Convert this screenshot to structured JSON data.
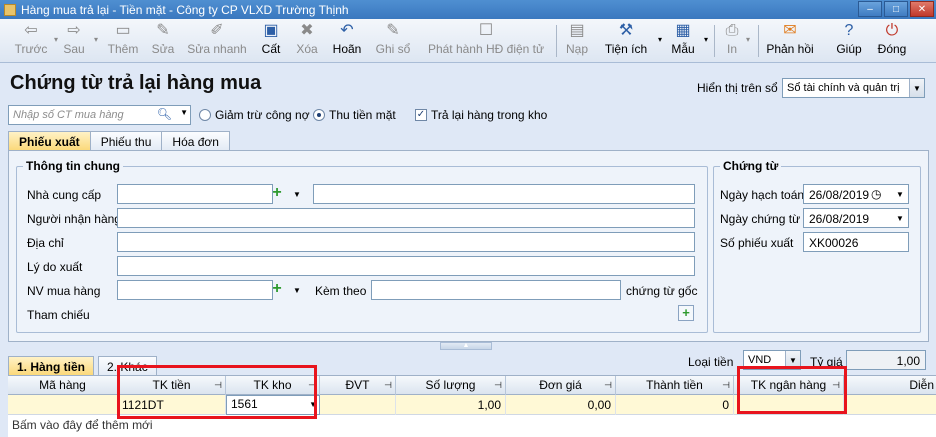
{
  "window": {
    "title": "Hàng mua trả lại - Tiền mặt - Công ty CP VLXD Trường Thịnh",
    "minimize": "–",
    "maximize": "□",
    "close": "✕"
  },
  "toolbar": {
    "back": "Trước",
    "next": "Sau",
    "add": "Thêm",
    "edit": "Sửa",
    "quick_edit": "Sửa nhanh",
    "save": "Cất",
    "delete": "Xóa",
    "undo": "Hoãn",
    "post": "Ghi sổ",
    "issue_invoice": "Phát hành HĐ điện tử",
    "load": "Nạp",
    "utilities": "Tiện ích",
    "template": "Mẫu",
    "print": "In",
    "feedback": "Phản hồi",
    "help": "Giúp",
    "close": "Đóng"
  },
  "header": {
    "title": "Chứng từ trả lại hàng mua",
    "display_label": "Hiển thị trên sổ",
    "display_value": "Sổ tài chính và quản trị"
  },
  "options": {
    "search_placeholder": "Nhập số CT mua hàng",
    "radio_debt": "Giảm trừ công nợ",
    "radio_cash": "Thu tiền mặt",
    "check_warehouse": "Trả lại hàng trong kho"
  },
  "tabs": [
    "Phiếu xuất",
    "Phiếu thu",
    "Hóa đơn"
  ],
  "general": {
    "title": "Thông tin chung",
    "supplier": "Nhà cung cấp",
    "receiver": "Người nhận hàng",
    "address": "Địa chỉ",
    "reason": "Lý do xuất",
    "buyer": "NV mua hàng",
    "attached": "Kèm theo",
    "original_docs": "chứng từ gốc",
    "reference": "Tham chiếu"
  },
  "voucher": {
    "title": "Chứng từ",
    "posting_date_label": "Ngày hạch toán",
    "posting_date": "26/08/2019",
    "voucher_date_label": "Ngày chứng từ",
    "voucher_date": "26/08/2019",
    "number_label": "Số phiếu xuất",
    "number": "XK00026"
  },
  "bottom": {
    "tab_money": "1. Hàng tiền",
    "tab_other": "2. Khác",
    "currency_label": "Loại tiền",
    "currency": "VND",
    "rate_label": "Tỷ giá",
    "rate": "1,00"
  },
  "grid": {
    "columns": [
      "Mã hàng",
      "TK tiền",
      "TK kho",
      "ĐVT",
      "Số lượng",
      "Đơn giá",
      "Thành tiền",
      "TK ngân hàng",
      "Diễn"
    ],
    "row": {
      "code": "",
      "cash_account": "1121DT",
      "stock_account": "1561",
      "unit": "",
      "quantity": "1,00",
      "unit_price": "0,00",
      "amount": "0",
      "bank_account": ""
    },
    "add_row": "Bấm vào đây để thêm mới"
  }
}
